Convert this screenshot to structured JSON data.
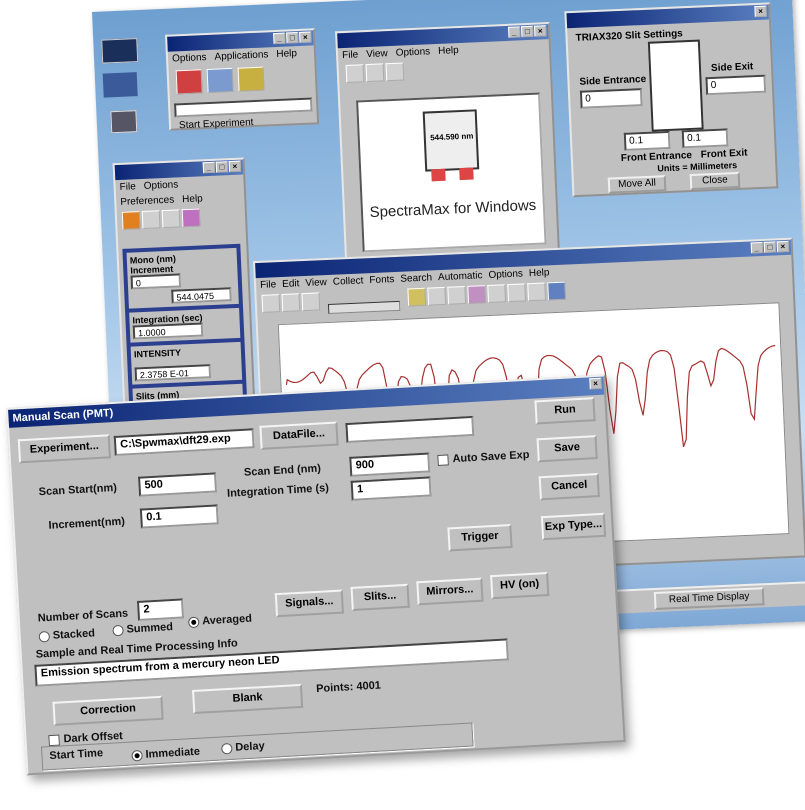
{
  "exp_window": {
    "menu": [
      "Options",
      "Applications",
      "Help"
    ],
    "status": "Start Experiment"
  },
  "spectra_window": {
    "menu": [
      "File",
      "View",
      "Options",
      "Help"
    ],
    "splash_title": "SpectraMax for Windows",
    "wavelength": "544.590 nm"
  },
  "slit_window": {
    "heading": "TRIAX320 Slit Settings",
    "side_entrance_label": "Side Entrance",
    "side_entrance": "0",
    "side_exit_label": "Side Exit",
    "side_exit": "0",
    "front_entrance": "0.1",
    "front_exit": "0.1",
    "front_entrance_label": "Front Entrance",
    "front_exit_label": "Front Exit",
    "units": "Units = Millimeters",
    "move_all": "Move All",
    "close": "Close"
  },
  "realtime_panel": {
    "menu": [
      "File",
      "Options",
      "Preferences",
      "Help"
    ],
    "mono_label": "Mono (nm)",
    "increment_label": "Increment",
    "increment": "0",
    "mono_value": "544.0475",
    "integration_label": "Integration (sec)",
    "integration": "1.0000",
    "intensity_label": "INTENSITY",
    "intensity": "2.3758 E-01",
    "slits_label": "Slits (mm)"
  },
  "graph_window": {
    "menu": [
      "File",
      "Edit",
      "View",
      "Collect",
      "Fonts",
      "Search",
      "Automatic",
      "Options",
      "Help"
    ]
  },
  "taskbar": {
    "item": "Real Time Display"
  },
  "dialog": {
    "title": "Manual Scan (PMT)",
    "experiment_btn": "Experiment...",
    "experiment_path": "C:\\Spwmax\\dft29.exp",
    "datafile_btn": "DataFile...",
    "run": "Run",
    "save": "Save",
    "cancel": "Cancel",
    "exp_type": "Exp Type...",
    "scan_start_label": "Scan Start(nm)",
    "scan_start": "500",
    "scan_end_label": "Scan End   (nm)",
    "scan_end": "900",
    "auto_save": "Auto Save Exp",
    "increment_label": "Increment(nm)",
    "increment": "0.1",
    "integration_label": "Integration Time (s)",
    "integration": "1",
    "trigger": "Trigger",
    "num_scans_label": "Number of Scans",
    "num_scans": "2",
    "stacked": "Stacked",
    "summed": "Summed",
    "averaged": "Averaged",
    "signals": "Signals...",
    "slits": "Slits...",
    "mirrors": "Mirrors...",
    "hv": "HV (on)",
    "info_label": "Sample and Real Time Processing Info",
    "info_text": "Emission spectrum from a mercury neon LED",
    "correction": "Correction",
    "blank": "Blank",
    "points": "Points:  4001",
    "dark_offset": "Dark Offset",
    "start_time": "Start Time",
    "immediate": "Immediate",
    "delay": "Delay"
  }
}
